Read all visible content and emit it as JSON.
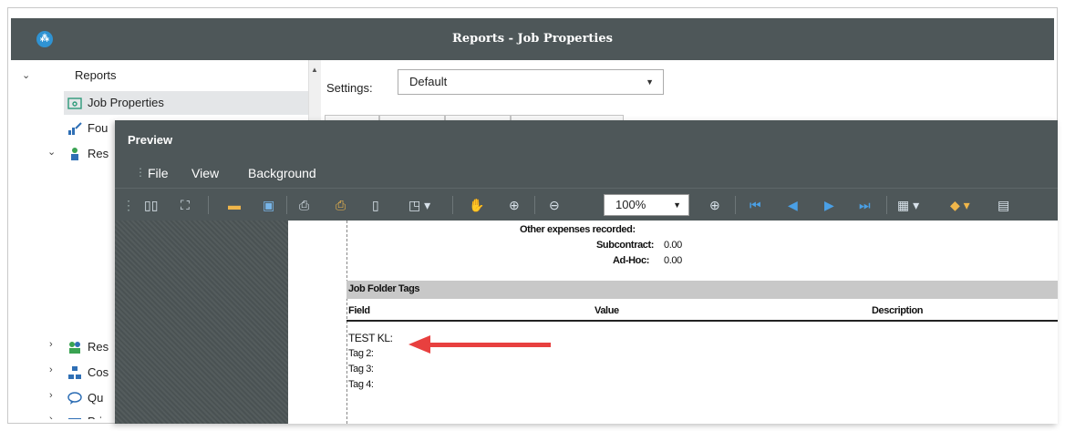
{
  "window": {
    "title": "Reports - Job Properties"
  },
  "tree": {
    "root_label": "Reports",
    "items": [
      {
        "label": "Job Properties"
      },
      {
        "label": "Fou"
      },
      {
        "label": "Res"
      },
      {
        "label": "Res"
      },
      {
        "label": "Cos"
      },
      {
        "label": "Qu"
      },
      {
        "label": "Pric"
      }
    ]
  },
  "settings": {
    "label": "Settings:",
    "value": "Default"
  },
  "preview": {
    "title": "Preview",
    "menu": [
      "File",
      "View",
      "Background"
    ],
    "zoom": "100%"
  },
  "report": {
    "other_expenses_label": "Other expenses recorded:",
    "subcontract_label": "Subcontract:",
    "subcontract_value": "0.00",
    "adhoc_label": "Ad-Hoc:",
    "adhoc_value": "0.00",
    "section_title": "Job Folder Tags",
    "columns": [
      "Field",
      "Value",
      "Description"
    ],
    "rows": [
      "TEST KL:",
      "Tag 2:",
      "Tag 3:",
      "Tag 4:"
    ]
  },
  "colors": {
    "titlebar": "#4e5759",
    "arrow": "#e8403f",
    "accent_blue": "#2f93d3"
  }
}
